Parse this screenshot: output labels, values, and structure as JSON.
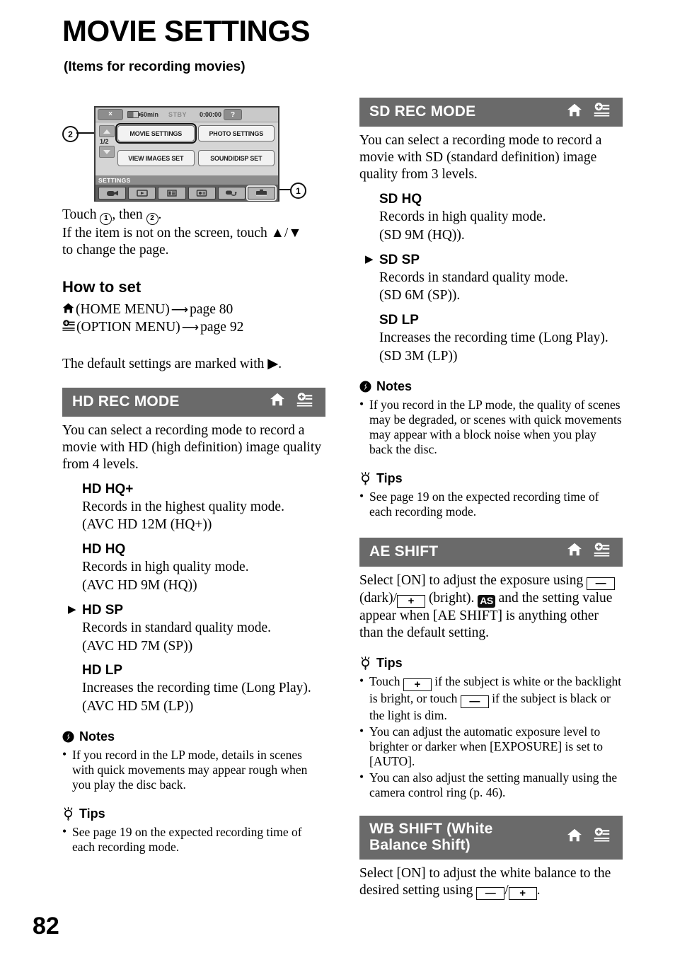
{
  "page": {
    "title": "MOVIE SETTINGS",
    "subtitle": "(Items for recording movies)",
    "number": "82"
  },
  "diagram": {
    "status_bar": {
      "close_label": "×",
      "battery_time": "60min",
      "mode": "STBY",
      "timecode": "0:00:00",
      "help_label": "?"
    },
    "page_indicator": "1/2",
    "menu_buttons": [
      "MOVIE SETTINGS",
      "PHOTO SETTINGS",
      "VIEW IMAGES SET",
      "SOUND/DISP SET"
    ],
    "selected_menu_button": "MOVIE SETTINGS",
    "category_label": "SETTINGS",
    "tabs": [
      "camera-tab-icon",
      "view-images-tab-icon",
      "others-tab-icon",
      "manage-media-tab-icon",
      "edit-tab-icon",
      "settings-tab-icon"
    ],
    "selected_tab": "settings-tab-icon",
    "callouts": [
      "1",
      "2"
    ]
  },
  "intro": {
    "line1_pre": "Touch ",
    "line1_mid": ", then ",
    "line1_post": ".",
    "callout_a": "1",
    "callout_b": "2",
    "line2": "If the item is not on the screen, touch ▲/▼",
    "line3": "to change the page."
  },
  "how_to_set": {
    "heading": "How to set",
    "home_text": "(HOME MENU)",
    "home_arrow": "⟶",
    "home_page": "page 80",
    "option_text": "(OPTION MENU)",
    "option_arrow": "⟶",
    "option_page": "page 92",
    "default_note": "The default settings are marked with ▶."
  },
  "sections": {
    "hd_rec_mode": {
      "title": "HD REC MODE",
      "body": "You can select a recording mode to record a movie with HD (high definition) image quality from 4 levels.",
      "options": [
        {
          "name": "HD HQ+",
          "default": false,
          "desc1": "Records in the highest quality mode.",
          "desc2": "(AVC HD 12M (HQ+))"
        },
        {
          "name": "HD HQ",
          "default": false,
          "desc1": "Records in high quality mode.",
          "desc2": "(AVC HD 9M (HQ))"
        },
        {
          "name": "HD SP",
          "default": true,
          "desc1": "Records in standard quality mode.",
          "desc2": "(AVC HD 7M (SP))"
        },
        {
          "name": "HD LP",
          "default": false,
          "desc1": "Increases the recording time (Long Play).",
          "desc2": "(AVC HD 5M (LP))"
        }
      ],
      "notes_heading": "Notes",
      "notes": [
        "If you record in the LP mode, details in scenes with quick movements may appear rough when you play the disc back."
      ],
      "tips_heading": "Tips",
      "tips": [
        "See page 19 on the expected recording time of each recording mode."
      ]
    },
    "sd_rec_mode": {
      "title": "SD REC MODE",
      "body": "You can select a recording mode to record a movie with SD (standard definition) image quality from 3 levels.",
      "options": [
        {
          "name": "SD HQ",
          "default": false,
          "desc1": "Records in high quality mode.",
          "desc2": "(SD 9M (HQ))."
        },
        {
          "name": "SD SP",
          "default": true,
          "desc1": "Records in standard quality mode.",
          "desc2": "(SD 6M (SP))."
        },
        {
          "name": "SD LP",
          "default": false,
          "desc1": "Increases the recording time (Long Play).",
          "desc2": "(SD 3M (LP))"
        }
      ],
      "notes_heading": "Notes",
      "notes": [
        "If you record in the LP mode, the quality of scenes may be degraded, or scenes with quick movements may appear with a block noise when you play back the disc."
      ],
      "tips_heading": "Tips",
      "tips": [
        "See page 19 on the expected recording time of each recording mode."
      ]
    },
    "ae_shift": {
      "title": "AE SHIFT",
      "body_1": "Select [ON] to adjust the exposure using",
      "minus_key": "—",
      "body_2": "(dark)/",
      "plus_key": "+",
      "body_3": "(bright).",
      "as_badge": "AS",
      "body_4": "and the setting value appear when [AE SHIFT] is anything other than the default setting.",
      "tips_heading": "Tips",
      "tip1_a": "Touch",
      "tip1_b": "if the subject is white or the backlight is bright, or touch",
      "tip1_c": "if the subject is black or the light is dim.",
      "tip2": "You can adjust the automatic exposure level to brighter or darker when [EXPOSURE] is set to [AUTO].",
      "tip3": "You can also adjust the setting manually using the camera control ring (p. 46)."
    },
    "wb_shift": {
      "title_line1": "WB SHIFT (White",
      "title_line2": "Balance Shift)",
      "body_1": "Select [ON] to adjust the white balance to the desired setting using",
      "minus_key": "—",
      "slash": "/",
      "plus_key": "+",
      "body_2": "."
    }
  },
  "colors": {
    "header_bar": "#6a6a6a",
    "header_text": "#ffffff",
    "text": "#000000",
    "lcd_bg": "#d5d5d5"
  }
}
